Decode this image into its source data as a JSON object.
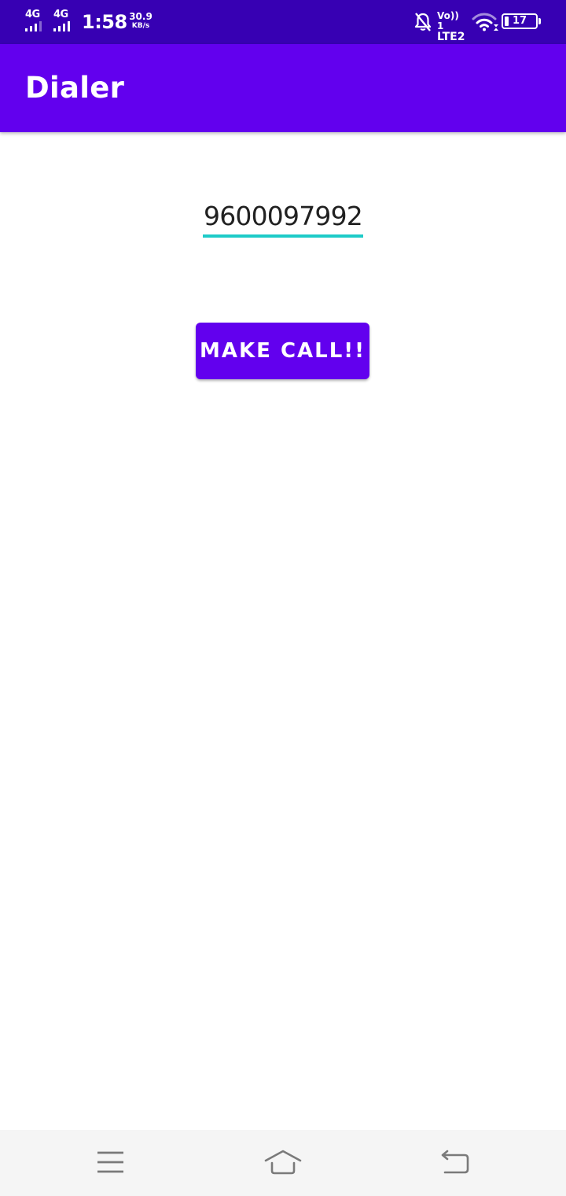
{
  "status_bar": {
    "network_1": "4G",
    "network_2": "4G",
    "time": "1:58",
    "speed_value": "30.9",
    "speed_unit": "KB/s",
    "volte_top": "Vo)) 1",
    "volte_bottom": "LTE2",
    "battery_level": "17"
  },
  "app_bar": {
    "title": "Dialer"
  },
  "dialer": {
    "phone_value": "9600097992",
    "call_button_label": "MAKE CALL!!"
  },
  "colors": {
    "status_bar": "#3700b3",
    "primary": "#6200ee",
    "input_underline": "#1ecbc8"
  }
}
